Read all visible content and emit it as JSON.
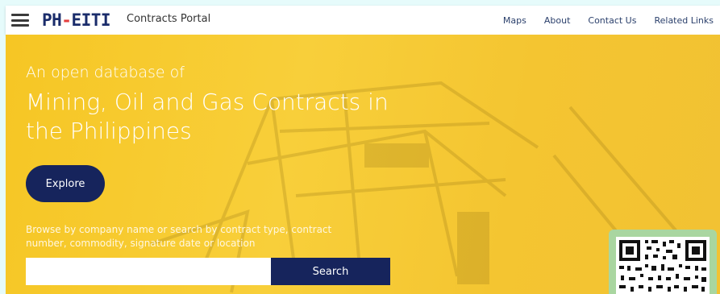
{
  "header": {
    "logo_ph": "PH",
    "logo_dash": "-",
    "logo_eiti": "EITI",
    "portal_title": "Contracts Portal",
    "nav": [
      "Maps",
      "About",
      "Contact Us",
      "Related Links"
    ]
  },
  "hero": {
    "subtitle": "An open database of",
    "title": "Mining, Oil and Gas Contracts in the Philippines",
    "explore_label": "Explore",
    "browse_text": "Browse by company name or search by contract type, contract number, commodity, signature date or location",
    "search_value": "",
    "search_button": "Search"
  },
  "colors": {
    "hero_bg": "#f6c624",
    "accent_navy": "#16245c",
    "logo_red": "#e43d3d",
    "qr_frame": "#a9d6a0"
  },
  "icons": [
    "hamburger-menu-icon",
    "qr-code-icon"
  ]
}
